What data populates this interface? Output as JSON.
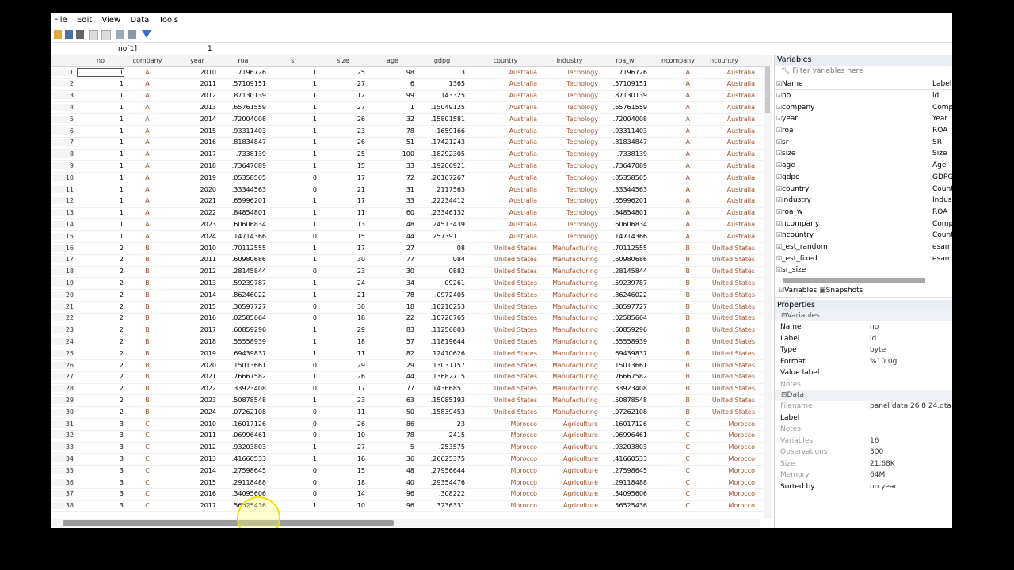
{
  "menu": [
    "File",
    "Edit",
    "View",
    "Data",
    "Tools"
  ],
  "cmd": {
    "cellref": "no[1]",
    "value": "1"
  },
  "columns": [
    "no",
    "company",
    "year",
    "roa",
    "sr",
    "size",
    "age",
    "gdpg",
    "country",
    "industry",
    "roa_w",
    "ncompany",
    "ncountry"
  ],
  "rows": [
    [
      "1",
      "1",
      "A",
      "2010",
      ".7196726",
      "1",
      "25",
      "98",
      ".13",
      "Australia",
      "Techology",
      ".7196726",
      "A",
      "Australia"
    ],
    [
      "2",
      "1",
      "A",
      "2011",
      ".57109151",
      "1",
      "27",
      "6",
      ".1365",
      "Australia",
      "Techology",
      ".57109151",
      "A",
      "Australia"
    ],
    [
      "3",
      "1",
      "A",
      "2012",
      ".87130139",
      "1",
      "12",
      "99",
      ".143325",
      "Australia",
      "Techology",
      ".87130139",
      "A",
      "Australia"
    ],
    [
      "4",
      "1",
      "A",
      "2013",
      ".65761559",
      "1",
      "27",
      "1",
      ".15049125",
      "Australia",
      "Techology",
      ".65761559",
      "A",
      "Australia"
    ],
    [
      "5",
      "1",
      "A",
      "2014",
      ".72004008",
      "1",
      "26",
      "32",
      ".15801581",
      "Australia",
      "Techology",
      ".72004008",
      "A",
      "Australia"
    ],
    [
      "6",
      "1",
      "A",
      "2015",
      ".93311403",
      "1",
      "23",
      "78",
      ".1659166",
      "Australia",
      "Techology",
      ".93311403",
      "A",
      "Australia"
    ],
    [
      "7",
      "1",
      "A",
      "2016",
      ".81834847",
      "1",
      "26",
      "51",
      ".17421243",
      "Australia",
      "Techology",
      ".81834847",
      "A",
      "Australia"
    ],
    [
      "8",
      "1",
      "A",
      "2017",
      ".7338139",
      "1",
      "25",
      "100",
      ".18292305",
      "Australia",
      "Techology",
      ".7338139",
      "A",
      "Australia"
    ],
    [
      "9",
      "1",
      "A",
      "2018",
      ".73647089",
      "1",
      "15",
      "33",
      ".19206921",
      "Australia",
      "Techology",
      ".73647089",
      "A",
      "Australia"
    ],
    [
      "10",
      "1",
      "A",
      "2019",
      ".05358505",
      "0",
      "17",
      "72",
      ".20167267",
      "Australia",
      "Techology",
      ".05358505",
      "A",
      "Australia"
    ],
    [
      "11",
      "1",
      "A",
      "2020",
      ".33344563",
      "0",
      "21",
      "31",
      ".2117563",
      "Australia",
      "Techology",
      ".33344563",
      "A",
      "Australia"
    ],
    [
      "12",
      "1",
      "A",
      "2021",
      ".65996201",
      "1",
      "17",
      "33",
      ".22234412",
      "Australia",
      "Techology",
      ".65996201",
      "A",
      "Australia"
    ],
    [
      "13",
      "1",
      "A",
      "2022",
      ".84854801",
      "1",
      "11",
      "60",
      ".23346132",
      "Australia",
      "Techology",
      ".84854801",
      "A",
      "Australia"
    ],
    [
      "14",
      "1",
      "A",
      "2023",
      ".60606834",
      "1",
      "13",
      "48",
      ".24513439",
      "Australia",
      "Techology",
      ".60606834",
      "A",
      "Australia"
    ],
    [
      "15",
      "1",
      "A",
      "2024",
      ".14714366",
      "0",
      "15",
      "44",
      ".25739111",
      "Australia",
      "Techology",
      ".14714366",
      "A",
      "Australia"
    ],
    [
      "16",
      "2",
      "B",
      "2010",
      ".70112555",
      "1",
      "17",
      "27",
      ".08",
      "United States",
      "Manufacturing",
      ".70112555",
      "B",
      "United States"
    ],
    [
      "17",
      "2",
      "B",
      "2011",
      ".60980686",
      "1",
      "30",
      "77",
      ".084",
      "United States",
      "Manufacturing",
      ".60980686",
      "B",
      "United States"
    ],
    [
      "18",
      "2",
      "B",
      "2012",
      ".28145844",
      "0",
      "23",
      "30",
      ".0882",
      "United States",
      "Manufacturing",
      ".28145844",
      "B",
      "United States"
    ],
    [
      "19",
      "2",
      "B",
      "2013",
      ".59239787",
      "1",
      "24",
      "34",
      ".09261",
      "United States",
      "Manufacturing",
      ".59239787",
      "B",
      "United States"
    ],
    [
      "20",
      "2",
      "B",
      "2014",
      ".86246022",
      "1",
      "21",
      "78",
      ".0972405",
      "United States",
      "Manufacturing",
      ".86246022",
      "B",
      "United States"
    ],
    [
      "21",
      "2",
      "B",
      "2015",
      ".30597727",
      "0",
      "30",
      "18",
      ".10210253",
      "United States",
      "Manufacturing",
      ".30597727",
      "B",
      "United States"
    ],
    [
      "22",
      "2",
      "B",
      "2016",
      ".02585664",
      "0",
      "18",
      "22",
      ".10720765",
      "United States",
      "Manufacturing",
      ".02585664",
      "B",
      "United States"
    ],
    [
      "23",
      "2",
      "B",
      "2017",
      ".60859296",
      "1",
      "29",
      "83",
      ".11256803",
      "United States",
      "Manufacturing",
      ".60859296",
      "B",
      "United States"
    ],
    [
      "24",
      "2",
      "B",
      "2018",
      ".55558939",
      "1",
      "18",
      "57",
      ".11819644",
      "United States",
      "Manufacturing",
      ".55558939",
      "B",
      "United States"
    ],
    [
      "25",
      "2",
      "B",
      "2019",
      ".69439837",
      "1",
      "11",
      "82",
      ".12410626",
      "United States",
      "Manufacturing",
      ".69439837",
      "B",
      "United States"
    ],
    [
      "26",
      "2",
      "B",
      "2020",
      ".15013661",
      "0",
      "29",
      "29",
      ".13031157",
      "United States",
      "Manufacturing",
      ".15013661",
      "B",
      "United States"
    ],
    [
      "27",
      "2",
      "B",
      "2021",
      ".76667582",
      "1",
      "26",
      "44",
      ".13682715",
      "United States",
      "Manufacturing",
      ".76667582",
      "B",
      "United States"
    ],
    [
      "28",
      "2",
      "B",
      "2022",
      ".33923408",
      "0",
      "17",
      "77",
      ".14366851",
      "United States",
      "Manufacturing",
      ".33923408",
      "B",
      "United States"
    ],
    [
      "29",
      "2",
      "B",
      "2023",
      ".50878548",
      "1",
      "23",
      "63",
      ".15085193",
      "United States",
      "Manufacturing",
      ".50878548",
      "B",
      "United States"
    ],
    [
      "30",
      "2",
      "B",
      "2024",
      ".07262108",
      "0",
      "11",
      "50",
      ".15839453",
      "United States",
      "Manufacturing",
      ".07262108",
      "B",
      "United States"
    ],
    [
      "31",
      "3",
      "C",
      "2010",
      ".16017126",
      "0",
      "26",
      "86",
      ".23",
      "Morocco",
      "Agriculture",
      ".16017126",
      "C",
      "Morocco"
    ],
    [
      "32",
      "3",
      "C",
      "2011",
      ".06996461",
      "0",
      "10",
      "78",
      ".2415",
      "Morocco",
      "Agriculture",
      ".06996461",
      "C",
      "Morocco"
    ],
    [
      "33",
      "3",
      "C",
      "2012",
      ".93203803",
      "1",
      "27",
      "5",
      ".253575",
      "Morocco",
      "Agriculture",
      ".93203803",
      "C",
      "Morocco"
    ],
    [
      "34",
      "3",
      "C",
      "2013",
      ".41660533",
      "1",
      "16",
      "36",
      ".26625375",
      "Morocco",
      "Agriculture",
      ".41660533",
      "C",
      "Morocco"
    ],
    [
      "35",
      "3",
      "C",
      "2014",
      ".27598645",
      "0",
      "15",
      "48",
      ".27956644",
      "Morocco",
      "Agriculture",
      ".27598645",
      "C",
      "Morocco"
    ],
    [
      "36",
      "3",
      "C",
      "2015",
      ".29118488",
      "0",
      "18",
      "40",
      ".29354476",
      "Morocco",
      "Agriculture",
      ".29118488",
      "C",
      "Morocco"
    ],
    [
      "37",
      "3",
      "C",
      "2016",
      ".34095606",
      "0",
      "14",
      "96",
      ".308222",
      "Morocco",
      "Agriculture",
      ".34095606",
      "C",
      "Morocco"
    ],
    [
      "38",
      "3",
      "C",
      "2017",
      ".56525436",
      "1",
      "10",
      "96",
      ".3236331",
      "Morocco",
      "Agriculture",
      ".56525436",
      "C",
      "Morocco"
    ]
  ],
  "variables": {
    "title": "Variables",
    "filter_placeholder": "Filter variables here",
    "head_name": "Name",
    "head_label": "Label",
    "list": [
      {
        "name": "no",
        "label": "id"
      },
      {
        "name": "company",
        "label": "Comp"
      },
      {
        "name": "year",
        "label": "Year"
      },
      {
        "name": "roa",
        "label": "ROA"
      },
      {
        "name": "sr",
        "label": "SR"
      },
      {
        "name": "size",
        "label": "Size"
      },
      {
        "name": "age",
        "label": "Age"
      },
      {
        "name": "gdpg",
        "label": "GDPG"
      },
      {
        "name": "country",
        "label": "Count"
      },
      {
        "name": "industry",
        "label": "Indus"
      },
      {
        "name": "roa_w",
        "label": "ROA"
      },
      {
        "name": "ncompany",
        "label": "Comp"
      },
      {
        "name": "ncountry",
        "label": "Count"
      },
      {
        "name": "_est_random",
        "label": "esamp"
      },
      {
        "name": "_est_fixed",
        "label": "esamp"
      },
      {
        "name": "sr_size",
        "label": ""
      }
    ],
    "tab_variables": "Variables",
    "tab_snapshots": "Snapshots"
  },
  "properties": {
    "title": "Properties",
    "var_section": "Variables",
    "var_props": [
      {
        "k": "Name",
        "v": "no"
      },
      {
        "k": "Label",
        "v": "id"
      },
      {
        "k": "Type",
        "v": "byte"
      },
      {
        "k": "Format",
        "v": "%10.0g"
      },
      {
        "k": "Value label",
        "v": ""
      },
      {
        "k": "Notes",
        "v": ""
      }
    ],
    "data_section": "Data",
    "data_props": [
      {
        "k": "Filename",
        "v": "panel data 26 8 24.dta"
      },
      {
        "k": "Label",
        "v": ""
      },
      {
        "k": "Notes",
        "v": ""
      },
      {
        "k": "Variables",
        "v": "16"
      },
      {
        "k": "Observations",
        "v": "300"
      },
      {
        "k": "Size",
        "v": "21.68K"
      },
      {
        "k": "Memory",
        "v": "64M"
      },
      {
        "k": "Sorted by",
        "v": "no year"
      }
    ]
  }
}
